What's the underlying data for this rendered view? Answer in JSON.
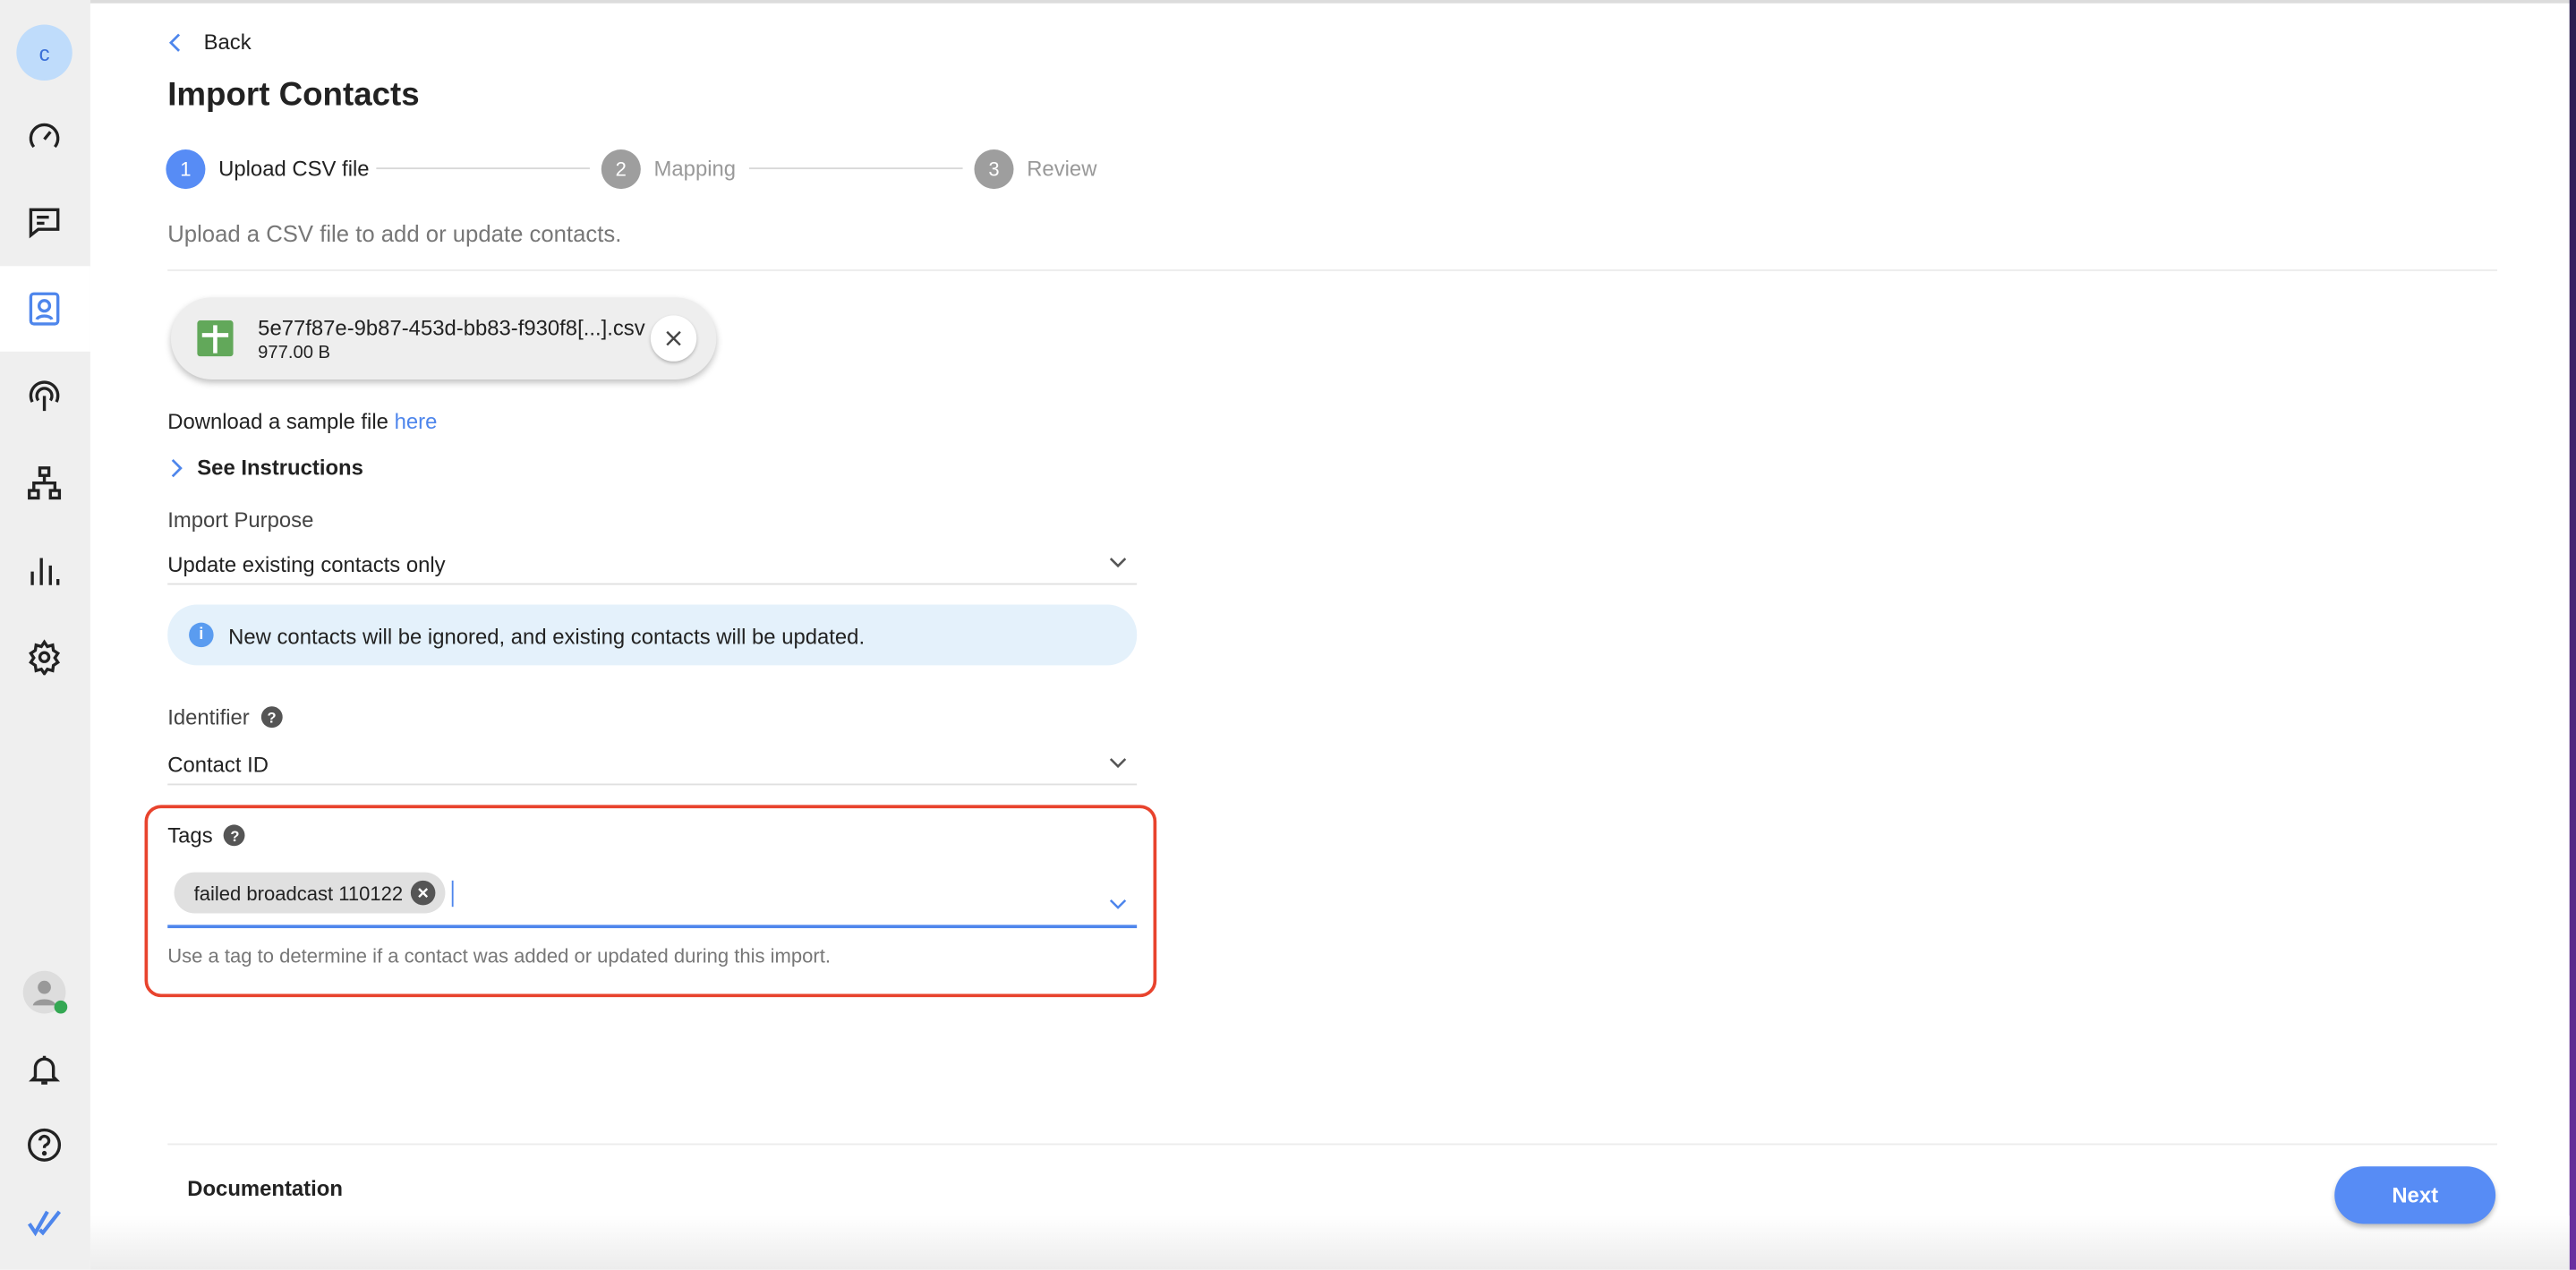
{
  "sidebar": {
    "avatar_letter": "c",
    "items": [
      {
        "icon": "dashboard-icon"
      },
      {
        "icon": "messages-icon"
      },
      {
        "icon": "contacts-icon",
        "active": true
      },
      {
        "icon": "broadcast-icon"
      },
      {
        "icon": "workflow-icon"
      },
      {
        "icon": "reports-icon"
      },
      {
        "icon": "settings-icon"
      }
    ],
    "bottom": [
      {
        "icon": "user-status-icon"
      },
      {
        "icon": "bell-icon"
      },
      {
        "icon": "help-icon"
      },
      {
        "icon": "logo-icon"
      }
    ],
    "status_color": "#34a853"
  },
  "header": {
    "back_label": "Back",
    "title": "Import Contacts"
  },
  "stepper": [
    {
      "num": "1",
      "label": "Upload CSV file",
      "active": true
    },
    {
      "num": "2",
      "label": "Mapping",
      "active": false
    },
    {
      "num": "3",
      "label": "Review",
      "active": false
    }
  ],
  "description": "Upload a CSV file to add or update contacts.",
  "file": {
    "name": "5e77f87e-9b87-453d-bb83-f930f8[...].csv",
    "size": "977.00 B"
  },
  "sample": {
    "text": "Download a sample file ",
    "link": "here"
  },
  "instructions_label": "See Instructions",
  "import_purpose": {
    "label": "Import Purpose",
    "value": "Update existing contacts only"
  },
  "info_message": "New contacts will be ignored, and existing contacts will be updated.",
  "identifier": {
    "label": "Identifier",
    "value": "Contact ID"
  },
  "tags": {
    "label": "Tags",
    "chips": [
      "failed broadcast 110122"
    ],
    "helper": "Use a tag to determine if a contact was added or updated during this import."
  },
  "footer": {
    "documentation_label": "Documentation",
    "next_label": "Next"
  },
  "colors": {
    "accent": "#4e86ec",
    "highlight": "#e8432d",
    "info_bg": "#e4f1fb"
  }
}
